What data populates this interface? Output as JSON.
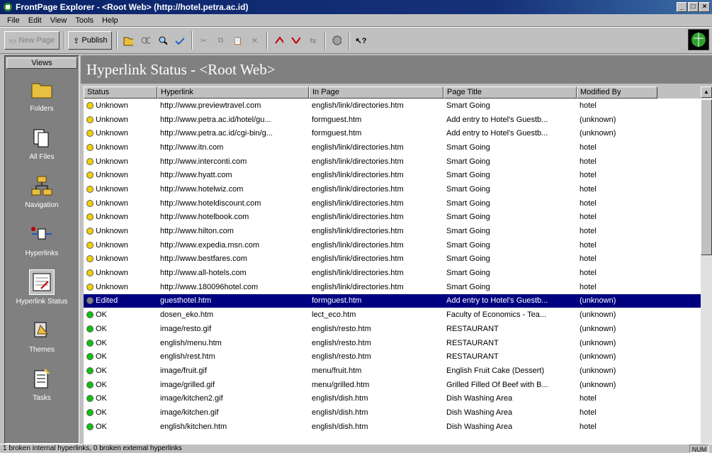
{
  "window": {
    "title": "FrontPage Explorer - <Root Web> (http://hotel.petra.ac.id)"
  },
  "menu": [
    "File",
    "Edit",
    "View",
    "Tools",
    "Help"
  ],
  "toolbar": {
    "new_page": "New Page",
    "publish": "Publish"
  },
  "views": {
    "header": "Views",
    "items": [
      {
        "label": "Folders"
      },
      {
        "label": "All Files"
      },
      {
        "label": "Navigation"
      },
      {
        "label": "Hyperlinks"
      },
      {
        "label": "Hyperlink Status"
      },
      {
        "label": "Themes"
      },
      {
        "label": "Tasks"
      }
    ]
  },
  "pane": {
    "title": "Hyperlink Status - <Root Web>"
  },
  "table": {
    "columns": [
      "Status",
      "Hyperlink",
      "In Page",
      "Page Title",
      "Modified By"
    ],
    "rows": [
      [
        "Unknown",
        "http://www.previewtravel.com",
        "english/link/directories.htm",
        "Smart Going",
        "hotel"
      ],
      [
        "Unknown",
        "http://www.petra.ac.id/hotel/gu...",
        "formguest.htm",
        "Add entry to Hotel's Guestb...",
        "(unknown)"
      ],
      [
        "Unknown",
        "http://www.petra.ac.id/cgi-bin/g...",
        "formguest.htm",
        "Add entry to Hotel's Guestb...",
        "(unknown)"
      ],
      [
        "Unknown",
        "http://www.itn.com",
        "english/link/directories.htm",
        "Smart Going",
        "hotel"
      ],
      [
        "Unknown",
        "http://www.interconti.com",
        "english/link/directories.htm",
        "Smart Going",
        "hotel"
      ],
      [
        "Unknown",
        "http://www.hyatt.com",
        "english/link/directories.htm",
        "Smart Going",
        "hotel"
      ],
      [
        "Unknown",
        "http://www.hotelwiz.com",
        "english/link/directories.htm",
        "Smart Going",
        "hotel"
      ],
      [
        "Unknown",
        "http://www.hoteldiscount.com",
        "english/link/directories.htm",
        "Smart Going",
        "hotel"
      ],
      [
        "Unknown",
        "http://www.hotelbook.com",
        "english/link/directories.htm",
        "Smart Going",
        "hotel"
      ],
      [
        "Unknown",
        "http://www.hilton.com",
        "english/link/directories.htm",
        "Smart Going",
        "hotel"
      ],
      [
        "Unknown",
        "http://www.expedia.msn.com",
        "english/link/directories.htm",
        "Smart Going",
        "hotel"
      ],
      [
        "Unknown",
        "http://www.bestfares.com",
        "english/link/directories.htm",
        "Smart Going",
        "hotel"
      ],
      [
        "Unknown",
        "http://www.all-hotels.com",
        "english/link/directories.htm",
        "Smart Going",
        "hotel"
      ],
      [
        "Unknown",
        "http://www.180096hotel.com",
        "english/link/directories.htm",
        "Smart Going",
        "hotel"
      ],
      [
        "Edited",
        "guesthotel.htm",
        "formguest.htm",
        "Add entry to Hotel's Guestb...",
        "(unknown)"
      ],
      [
        "OK",
        "dosen_eko.htm",
        "lect_eco.htm",
        "Faculty of Economics - Tea...",
        "(unknown)"
      ],
      [
        "OK",
        "image/resto.gif",
        "english/resto.htm",
        "RESTAURANT",
        "(unknown)"
      ],
      [
        "OK",
        "english/menu.htm",
        "english/resto.htm",
        "RESTAURANT",
        "(unknown)"
      ],
      [
        "OK",
        "english/rest.htm",
        "english/resto.htm",
        "RESTAURANT",
        "(unknown)"
      ],
      [
        "OK",
        "image/fruit.gif",
        "menu/fruit.htm",
        "English Fruit Cake (Dessert)",
        "(unknown)"
      ],
      [
        "OK",
        "image/grilled.gif",
        "menu/grilled.htm",
        "Grilled Filled Of Beef with B...",
        "(unknown)"
      ],
      [
        "OK",
        "image/kitchen2.gif",
        "english/dish.htm",
        "Dish Washing Area",
        "hotel"
      ],
      [
        "OK",
        "image/kitchen.gif",
        "english/dish.htm",
        "Dish Washing Area",
        "hotel"
      ],
      [
        "OK",
        "english/kitchen.htm",
        "english/dish.htm",
        "Dish Washing Area",
        "hotel"
      ]
    ],
    "selected_row": 14
  },
  "status_colors": {
    "Unknown": "#f0d000",
    "Edited": "#808080",
    "OK": "#10c010"
  },
  "statusbar": {
    "text": "1 broken internal hyperlinks, 0 broken external hyperlinks",
    "right": "NUM"
  }
}
